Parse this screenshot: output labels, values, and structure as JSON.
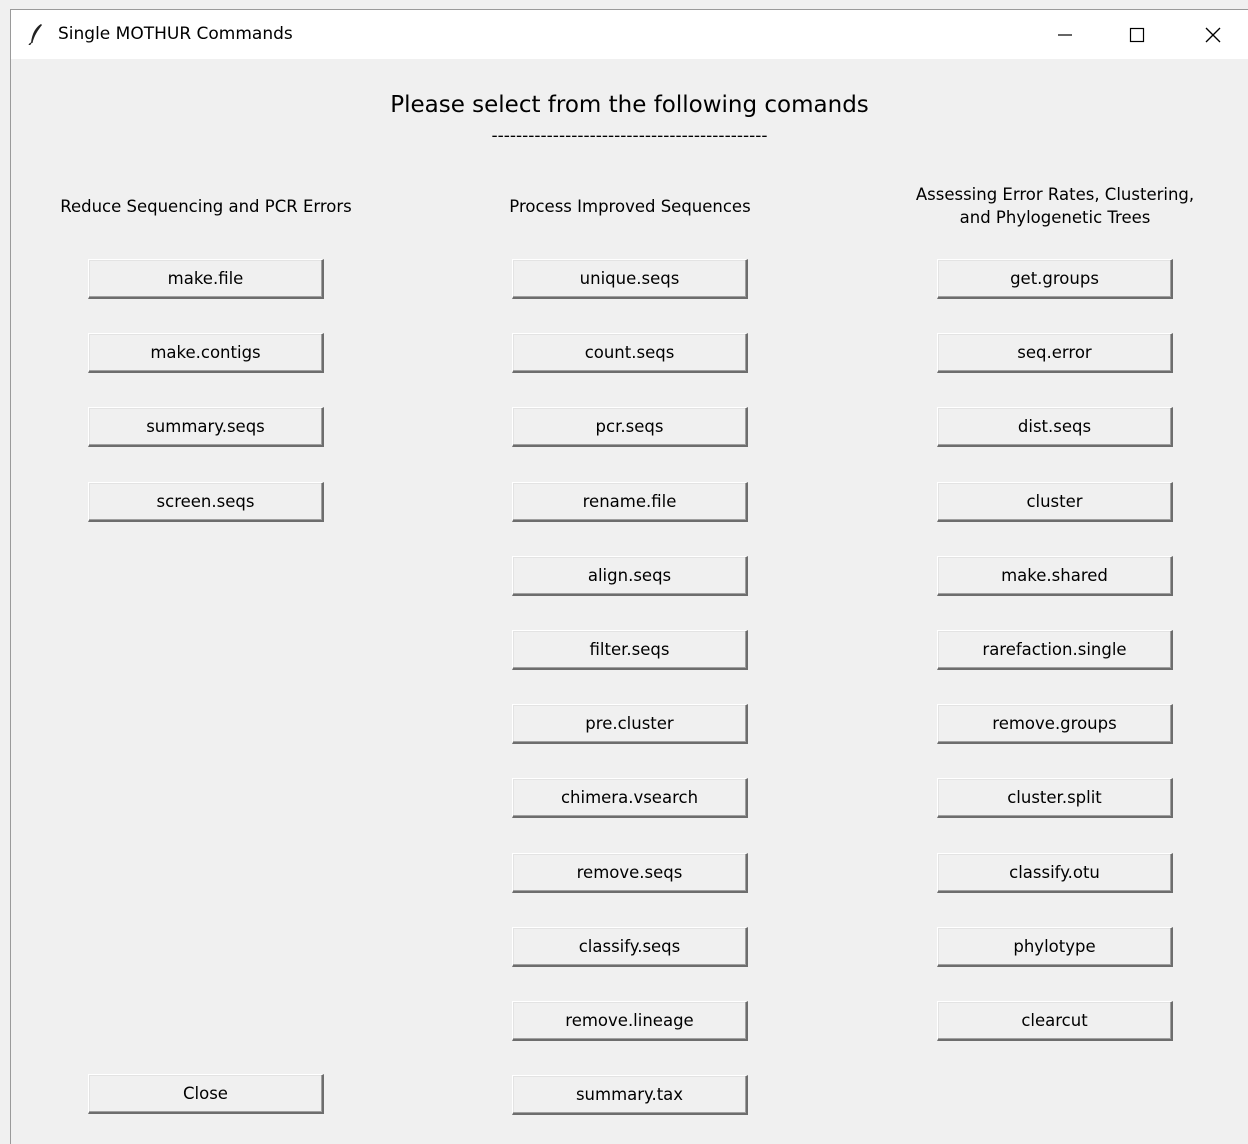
{
  "window": {
    "title": "Single MOTHUR Commands",
    "controls": {
      "minimize": "minimize-icon",
      "maximize": "maximize-icon",
      "close": "close-icon"
    }
  },
  "header": {
    "title": "Please select from the following comands",
    "divider": "---------------------------------------------"
  },
  "columns": [
    {
      "heading_lines": [
        "Reduce Sequencing and PCR Errors"
      ],
      "buttons": [
        "make.file",
        "make.contigs",
        "summary.seqs",
        "screen.seqs"
      ]
    },
    {
      "heading_lines": [
        "Process Improved Sequences"
      ],
      "buttons": [
        "unique.seqs",
        "count.seqs",
        "pcr.seqs",
        "rename.file",
        "align.seqs",
        "filter.seqs",
        "pre.cluster",
        "chimera.vsearch",
        "remove.seqs",
        "classify.seqs",
        "remove.lineage",
        "summary.tax"
      ]
    },
    {
      "heading_lines": [
        "Assessing Error Rates, Clustering,",
        "and Phylogenetic Trees"
      ],
      "buttons": [
        "get.groups",
        "seq.error",
        "dist.seqs",
        "cluster",
        "make.shared",
        "rarefaction.single",
        "remove.groups",
        "cluster.split",
        "classify.otu",
        "phylotype",
        "clearcut"
      ]
    }
  ],
  "footer": {
    "close_label": "Close"
  }
}
